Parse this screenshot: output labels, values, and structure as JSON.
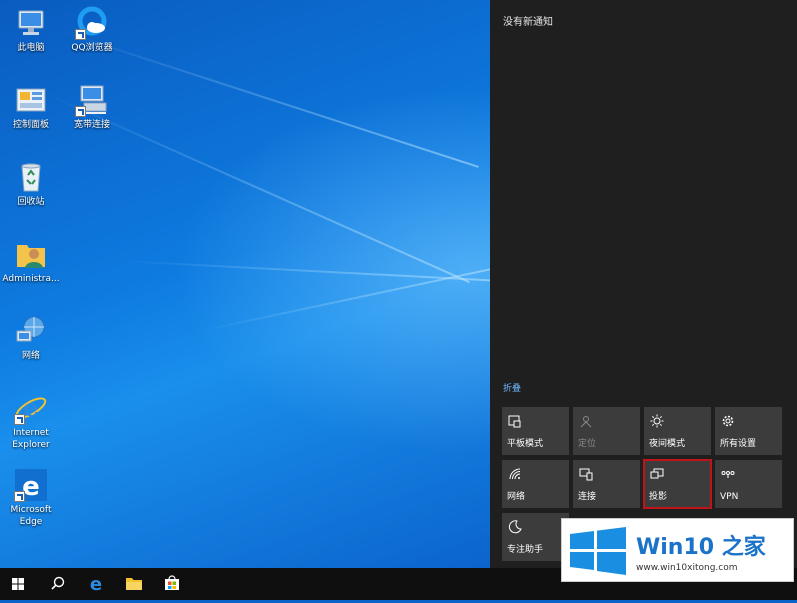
{
  "desktop": {
    "icons": [
      {
        "label": "此电脑",
        "icon": "this-pc-icon"
      },
      {
        "label": "QQ浏览器",
        "icon": "qq-browser-icon"
      },
      {
        "label": "控制面板",
        "icon": "control-panel-icon"
      },
      {
        "label": "宽带连接",
        "icon": "broadband-connection-icon"
      },
      {
        "label": "回收站",
        "icon": "recycle-bin-icon"
      },
      {
        "label": "Administra...",
        "icon": "user-folder-icon"
      },
      {
        "label": "网络",
        "icon": "network-icon"
      },
      {
        "label": "Internet Explorer",
        "icon": "internet-explorer-icon"
      },
      {
        "label": "Microsoft Edge",
        "icon": "edge-icon"
      }
    ]
  },
  "action_center": {
    "no_notifications": "没有新通知",
    "collapse": "折叠",
    "tiles": [
      {
        "label": "平板模式",
        "icon": "tablet-mode-icon",
        "state": "normal"
      },
      {
        "label": "定位",
        "icon": "location-icon",
        "state": "disabled"
      },
      {
        "label": "夜间模式",
        "icon": "night-light-icon",
        "state": "normal"
      },
      {
        "label": "所有设置",
        "icon": "settings-gear-icon",
        "state": "normal"
      },
      {
        "label": "网络",
        "icon": "wifi-icon",
        "state": "normal"
      },
      {
        "label": "连接",
        "icon": "connect-icon",
        "state": "normal"
      },
      {
        "label": "投影",
        "icon": "project-icon",
        "state": "highlighted"
      },
      {
        "label": "VPN",
        "icon": "vpn-icon",
        "state": "normal"
      },
      {
        "label": "专注助手",
        "icon": "focus-assist-moon-icon",
        "state": "normal"
      }
    ]
  },
  "taskbar": {
    "buttons": [
      "start-windows-icon",
      "search-icon",
      "edge-icon",
      "file-explorer-icon",
      "store-icon"
    ]
  },
  "watermark": {
    "title": "Win10 之家",
    "url": "www.win10xitong.com"
  },
  "colors": {
    "accent": "#0078d7",
    "action_center_bg": "#1f1f1f",
    "tile_bg": "#3c3c3c",
    "highlight_border": "#c0141b",
    "link_blue": "#6fb8ff"
  }
}
